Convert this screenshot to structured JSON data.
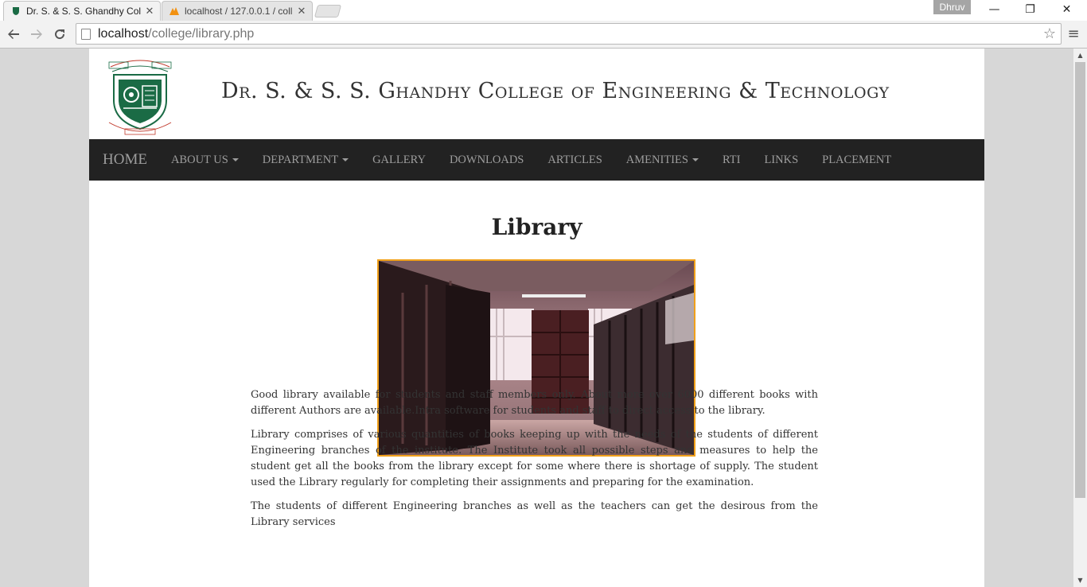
{
  "browser": {
    "tabs": [
      {
        "title": "Dr. S. & S. S. Ghandhy Col",
        "active": true
      },
      {
        "title": "localhost / 127.0.0.1 / coll",
        "active": false
      }
    ],
    "profile_name": "Dhruv",
    "url_host": "localhost",
    "url_path": "/college/library.php",
    "icons": {
      "back": "back-arrow-icon",
      "forward": "forward-arrow-icon",
      "reload": "reload-icon",
      "bookmark": "star-icon",
      "menu": "hamburger-menu-icon"
    }
  },
  "site": {
    "title": "Dr. S. & S. S. Ghandhy College of Engineering & Technology"
  },
  "nav": {
    "brand": "HOME",
    "items": [
      {
        "label": "ABOUT US",
        "dropdown": true
      },
      {
        "label": "DEPARTMENT",
        "dropdown": true
      },
      {
        "label": "GALLERY",
        "dropdown": false
      },
      {
        "label": "DOWNLOADS",
        "dropdown": false
      },
      {
        "label": "ARTICLES",
        "dropdown": false
      },
      {
        "label": "AMENITIES",
        "dropdown": true
      },
      {
        "label": "RTI",
        "dropdown": false
      },
      {
        "label": "LINKS",
        "dropdown": false
      },
      {
        "label": "PLACEMENT",
        "dropdown": false
      }
    ]
  },
  "main": {
    "heading": "Library",
    "paragraphs": [
      "Good library available for students and staff members only. About more over 6000 different books with different Authors are available.Intra software for students and staff to direct access to the library.",
      "Library comprises of various quantities of books keeping up with the needs of the students of different Engineering branches of the institute. The Institute took all possible steps and measures to help the student get all the books from the library except for some where there is shortage of supply. The student used the Library regularly for completing their assignments and preparing for the examination.",
      "The students of different Engineering branches as well as the teachers can get the desirous from the Library services"
    ]
  },
  "colors": {
    "navbar_bg": "#222222",
    "nav_text": "#9d9d9d",
    "photo_border": "#f0a01a",
    "logo_green": "#1a6b45",
    "logo_red": "#c0392b"
  }
}
